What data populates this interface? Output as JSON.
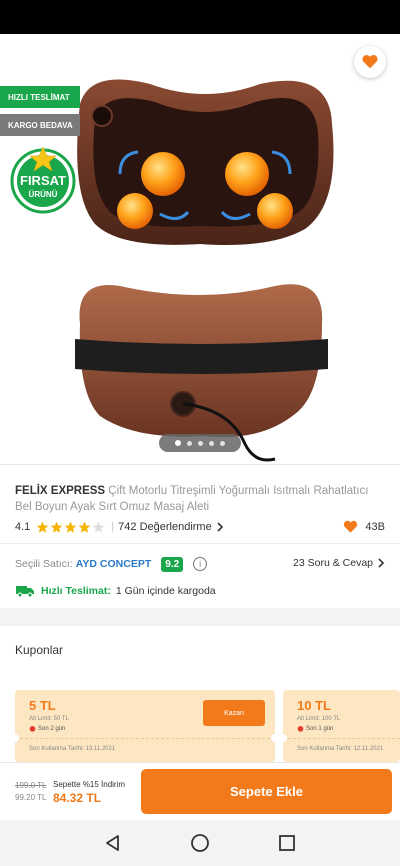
{
  "badges": {
    "fast_delivery": "HIZLI TESLİMAT",
    "free_cargo": "KARGO BEDAVA",
    "firsat_line1": "FIRSAT",
    "firsat_line2": "ÜRÜNÜ"
  },
  "carousel": {
    "total": 5,
    "active": 0
  },
  "product": {
    "brand": "FELİX EXPRESS",
    "title": " Çift Motorlu Titreşimli Yoğurmalı Isıtmalı Rahatlatıcı Bel Boyun Ayak Sırt Omuz Masaj Aleti",
    "rating": "4.1",
    "rating_value": 4.1,
    "reviews": "742 Değerlendirme",
    "likes": "43B"
  },
  "seller": {
    "label": "Seçili Satıcı:",
    "name": "AYD CONCEPT",
    "score": "9.2",
    "info_icon": "i",
    "qa": "23 Soru & Cevap"
  },
  "delivery": {
    "label": "Hızlı Teslimat:",
    "text": "1 Gün içinde kargoda"
  },
  "coupons": {
    "title": "Kuponlar",
    "items": [
      {
        "amount": "5 TL",
        "limit": "Alt Limit: 50 TL",
        "days": "Son 2 gün",
        "button": "Kazan",
        "expiry": "Son Kullanma Tarihi: 13.11.2021"
      },
      {
        "amount": "10 TL",
        "limit": "Alt Limit: 100 TL",
        "days": "Son 1 gün",
        "button": "",
        "expiry": "Son Kullanma Tarihi: 12.11.2021"
      }
    ]
  },
  "cart": {
    "old_price": "199.0 TL",
    "mid_price": "99.20 TL",
    "discount_label": "Sepette %15 İndirim",
    "new_price": "84.32 TL",
    "add_button": "Sepete Ekle"
  },
  "colors": {
    "accent": "#f27a1a",
    "green": "#1aa64a",
    "link": "#2a7ac5"
  },
  "icons": [
    "back-arrow-icon",
    "share-icon",
    "heart-icon",
    "star-icon",
    "chevron-right-icon",
    "info-icon",
    "truck-icon",
    "alarm-icon",
    "nav-back-icon",
    "nav-home-icon",
    "nav-recents-icon"
  ]
}
